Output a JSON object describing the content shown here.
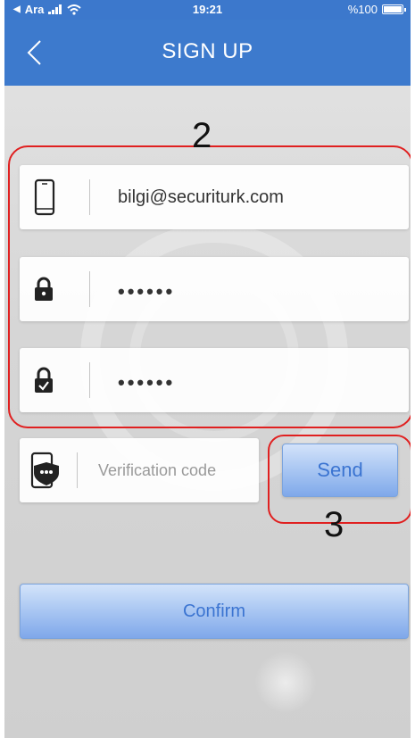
{
  "status_bar": {
    "carrier": "Ara",
    "time": "19:21",
    "battery": "%100"
  },
  "header": {
    "title": "SIGN UP"
  },
  "form": {
    "account": {
      "value": "bilgi@securiturk.com",
      "icon": "phone-icon"
    },
    "password": {
      "value": "••••••",
      "icon": "lock-icon"
    },
    "confirm_password": {
      "value": "••••••",
      "icon": "lock-check-icon"
    },
    "verification": {
      "placeholder": "Verification code",
      "icon": "phone-shield-icon"
    },
    "send_label": "Send",
    "confirm_label": "Confirm"
  },
  "annotations": {
    "fields_label": "2",
    "send_label": "3"
  },
  "colors": {
    "header_bg": "#3d7acd",
    "button_text": "#3b74d1",
    "annotation": "#e02020"
  }
}
